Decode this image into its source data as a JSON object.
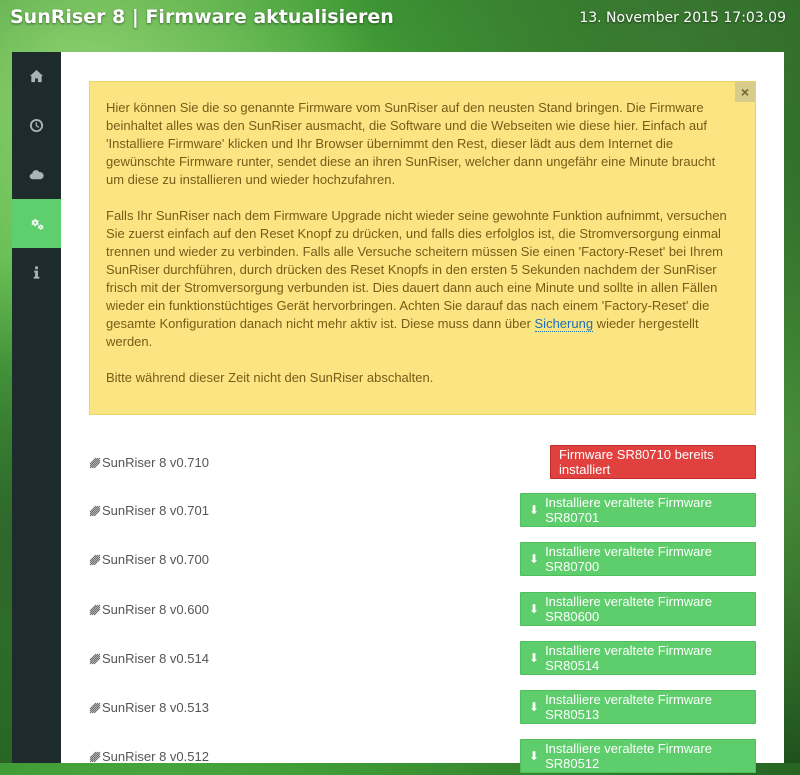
{
  "header": {
    "title": "SunRiser 8 | Firmware aktualisieren",
    "datetime": "13. November 2015 17:03.09"
  },
  "sidebar": {
    "items": [
      {
        "icon": "home-icon",
        "active": false
      },
      {
        "icon": "clock-icon",
        "active": false
      },
      {
        "icon": "cloud-icon",
        "active": false
      },
      {
        "icon": "gears-icon",
        "active": true
      },
      {
        "icon": "info-icon",
        "active": false
      }
    ]
  },
  "alert": {
    "close_label": "×",
    "p1": "Hier können Sie die so genannte Firmware vom SunRiser auf den neusten Stand bringen. Die Firmware beinhaltet alles was den SunRiser ausmacht, die Software und die Webseiten wie diese hier. Einfach auf 'Installiere Firmware' klicken und Ihr Browser übernimmt den Rest, dieser lädt aus dem Internet die gewünschte Firmware runter, sendet diese an ihren SunRiser, welcher dann ungefähr eine Minute braucht um diese zu installieren und wieder hochzufahren.",
    "p2_before_link": "Falls Ihr SunRiser nach dem Firmware Upgrade nicht wieder seine gewohnte Funktion aufnimmt, versuchen Sie zuerst einfach auf den Reset Knopf zu drücken, und falls dies erfolglos ist, die Stromversorgung einmal trennen und wieder zu verbinden. Falls alle Versuche scheitern müssen Sie einen 'Factory-Reset' bei Ihrem SunRiser durchführen, durch drücken des Reset Knopfs in den ersten 5 Sekunden nachdem der SunRiser frisch mit der Stromversorgung verbunden ist. Dies dauert dann auch eine Minute und sollte in allen Fällen wieder ein funktionstüchtiges Gerät hervorbringen. Achten Sie darauf das nach einem 'Factory-Reset' die gesamte Konfiguration danach nicht mehr aktiv ist. Diese muss dann über ",
    "p2_link": "Sicherung",
    "p2_after_link": " wieder hergestellt werden.",
    "p3": "Bitte während dieser Zeit nicht den SunRiser abschalten."
  },
  "firmware": [
    {
      "name": "SunRiser 8 v0.710",
      "button": "Firmware SR80710 bereits installiert",
      "installed": true
    },
    {
      "name": "SunRiser 8 v0.701",
      "button": "Installiere veraltete Firmware SR80701",
      "installed": false
    },
    {
      "name": "SunRiser 8 v0.700",
      "button": "Installiere veraltete Firmware SR80700",
      "installed": false
    },
    {
      "name": "SunRiser 8 v0.600",
      "button": "Installiere veraltete Firmware SR80600",
      "installed": false
    },
    {
      "name": "SunRiser 8 v0.514",
      "button": "Installiere veraltete Firmware SR80514",
      "installed": false
    },
    {
      "name": "SunRiser 8 v0.513",
      "button": "Installiere veraltete Firmware SR80513",
      "installed": false
    },
    {
      "name": "SunRiser 8 v0.512",
      "button": "Installiere veraltete Firmware SR80512",
      "installed": false
    }
  ],
  "colors": {
    "accent": "#5fce6d",
    "danger": "#e0413f",
    "alert_bg": "#fbe582",
    "sidebar_bg": "#1d2b2c"
  }
}
